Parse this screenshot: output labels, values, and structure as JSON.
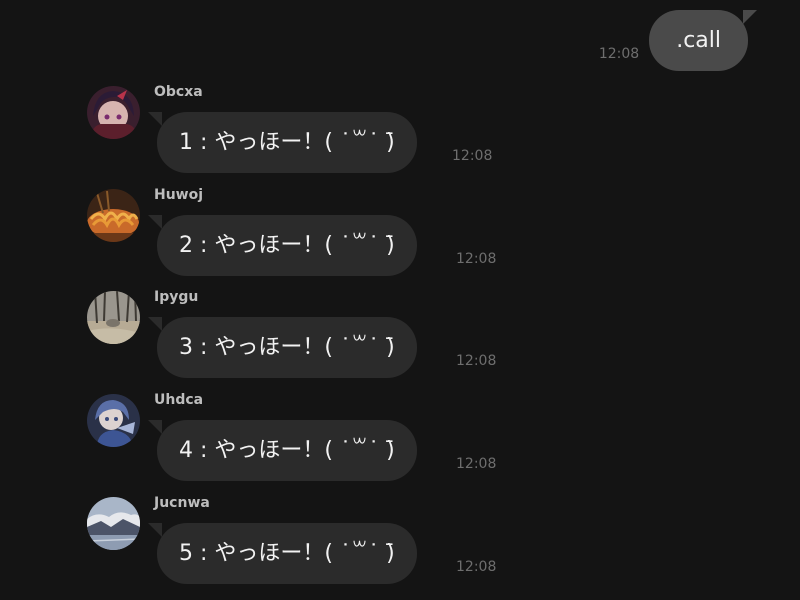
{
  "outgoing": {
    "text": ".call",
    "time": "12:08"
  },
  "messages": [
    {
      "sender": "Obcxa",
      "text": "1 : やっほー！( ˙꒳˙ )̄",
      "time": "12:08",
      "avatar_icon": "anime-character-avatar"
    },
    {
      "sender": "Huwoj",
      "text": "2 : やっほー！( ˙꒳˙ )̄",
      "time": "12:08",
      "avatar_icon": "noodles-food-avatar"
    },
    {
      "sender": "Ipygu",
      "text": "3 : やっほー！( ˙꒳˙ )̄",
      "time": "12:08",
      "avatar_icon": "forest-landscape-avatar"
    },
    {
      "sender": "Uhdca",
      "text": "4 : やっほー！( ˙꒳˙ )̄",
      "time": "12:08",
      "avatar_icon": "anime-character-blue-avatar"
    },
    {
      "sender": "Jucnwa",
      "text": "5 : やっほー！( ˙꒳˙ )̄",
      "time": "12:08",
      "avatar_icon": "cloudy-landscape-avatar"
    }
  ],
  "colors": {
    "background": "#141414",
    "outgoing_bubble": "#4a4a4a",
    "incoming_bubble": "#2b2b2b",
    "timestamp": "#6e6e6e"
  }
}
